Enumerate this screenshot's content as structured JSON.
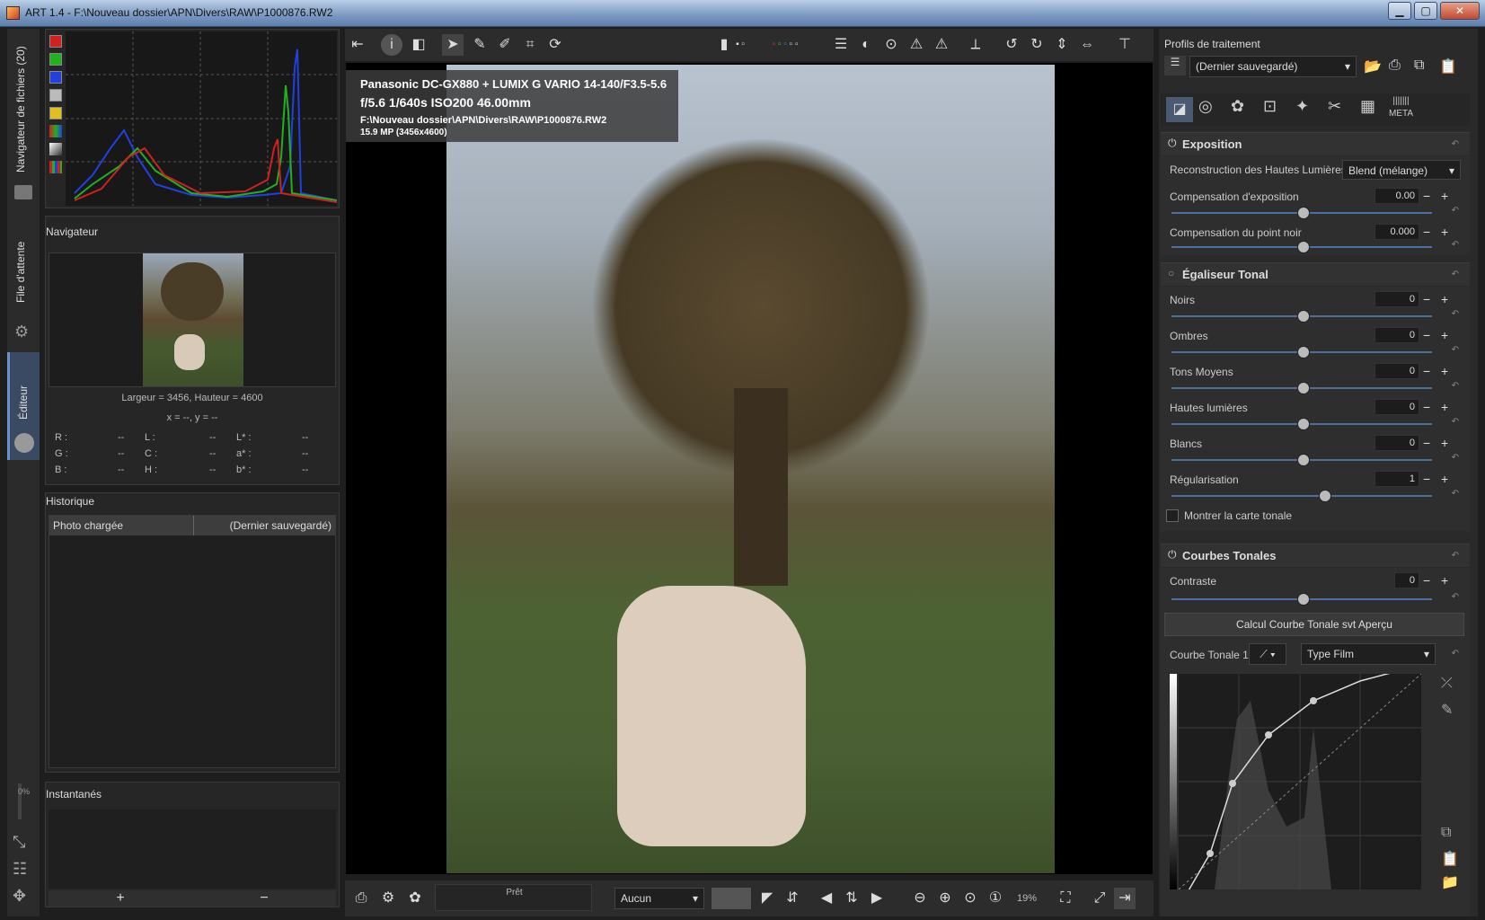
{
  "window": {
    "title": "ART 1.4 - F:\\Nouveau dossier\\APN\\Divers\\RAW\\P1000876.RW2",
    "min": "▁",
    "max": "▢",
    "close": "✕"
  },
  "vtabs": {
    "browser": "Navigateur de fichiers (20)",
    "queue": "File d'attente",
    "editor": "Éditeur",
    "progress": "0%"
  },
  "navigator": {
    "title": "Navigateur",
    "size": "Largeur = 3456, Hauteur = 4600",
    "coords": "x = --, y = --",
    "rows": [
      {
        "a": "R :",
        "av": "--",
        "b": "L :",
        "bv": "--",
        "c": "L* :",
        "cv": "--"
      },
      {
        "a": "G :",
        "av": "--",
        "b": "C :",
        "bv": "--",
        "c": "a* :",
        "cv": "--"
      },
      {
        "a": "B :",
        "av": "--",
        "b": "H :",
        "bv": "--",
        "c": "b* :",
        "cv": "--"
      }
    ]
  },
  "history": {
    "title": "Historique",
    "col1": "Photo chargée",
    "col2": "(Dernier sauvegardé)"
  },
  "snapshots": {
    "title": "Instantanés",
    "add": "+",
    "remove": "−"
  },
  "overlay": {
    "camera": "Panasonic DC-GX880 + LUMIX G VARIO 14-140/F3.5-5.6",
    "exposure": "f/5.6  1/640s  ISO200  46.00mm",
    "path": "F:\\Nouveau dossier\\APN\\Divers\\RAW\\P1000876.RW2",
    "mp": "15.9 MP (3456x4600)"
  },
  "bottom": {
    "status": "Prêt",
    "preview": "Aucun",
    "zoom": "19%"
  },
  "right": {
    "profiles_title": "Profils de traitement",
    "profile_value": "(Dernier sauvegardé)",
    "meta_tab": "META",
    "exposure": {
      "title": "Exposition",
      "hl_label": "Reconstruction des Hautes Lumières:",
      "hl_value": "Blend (mélange)",
      "comp_label": "Compensation d'exposition",
      "comp_value": "0.00",
      "black_label": "Compensation du point noir",
      "black_value": "0.000"
    },
    "tonal_eq": {
      "title": "Égaliseur Tonal",
      "rows": [
        {
          "label": "Noirs",
          "value": "0"
        },
        {
          "label": "Ombres",
          "value": "0"
        },
        {
          "label": "Tons Moyens",
          "value": "0"
        },
        {
          "label": "Hautes lumières",
          "value": "0"
        },
        {
          "label": "Blancs",
          "value": "0"
        },
        {
          "label": "Régularisation",
          "value": "1"
        }
      ],
      "show_map": "Montrer la carte tonale"
    },
    "curves": {
      "title": "Courbes Tonales",
      "contrast_label": "Contraste",
      "contrast_value": "0",
      "calc_button": "Calcul Courbe Tonale svt Aperçu",
      "curve_label": "Courbe Tonale 1:",
      "curve_type": "Type Film"
    }
  },
  "colors": {
    "accent": "#4a6fa0",
    "panel": "#2a2a2a",
    "bg": "#1e1e1e"
  }
}
